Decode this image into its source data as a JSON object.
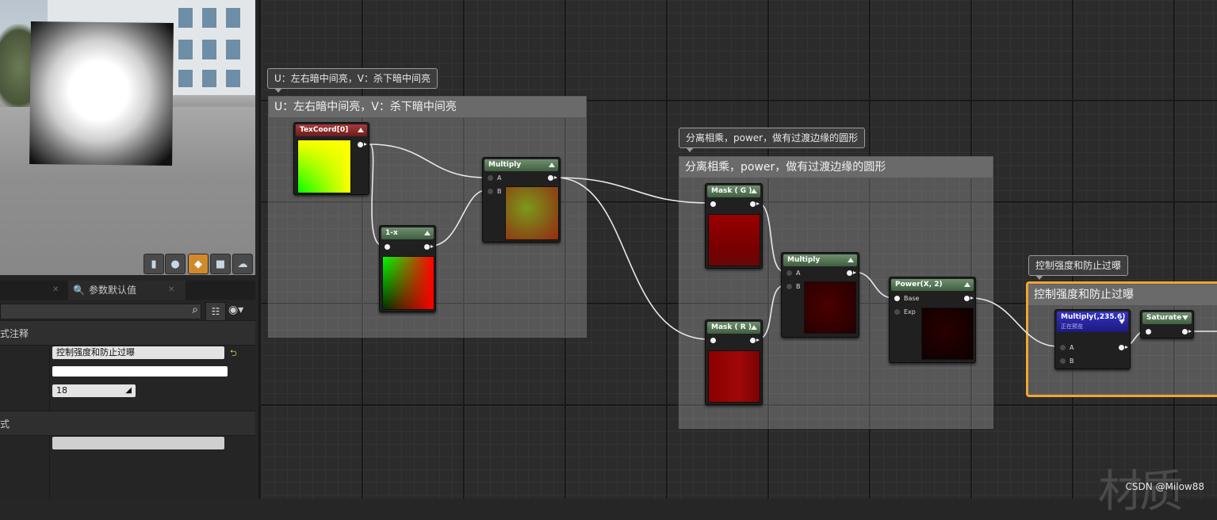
{
  "viewport": {
    "buttons": [
      "cylinder",
      "sphere",
      "plane",
      "cube",
      "custom-mesh"
    ],
    "active_button": "plane"
  },
  "details_panel": {
    "tab_label": "参数默认值",
    "section1_label": "式注释",
    "comment_text": "控制强度和防止过曝",
    "font_size": "18",
    "section2_label": "式"
  },
  "comments": [
    {
      "bubble": "U：左右暗中间亮，V：杀下暗中间亮",
      "title": "U：左右暗中间亮，V：杀下暗中间亮"
    },
    {
      "bubble": "分离相乘，power，做有过渡边缘的圆形",
      "title": "分离相乘，power，做有过渡边缘的圆形"
    },
    {
      "bubble": "控制强度和防止过曝",
      "title": "控制强度和防止过曝"
    }
  ],
  "nodes": {
    "texcoord": {
      "title": "TexCoord[0]"
    },
    "oneminus": {
      "title": "1-x"
    },
    "multiply1": {
      "title": "Multiply",
      "pin_a": "A",
      "pin_b": "B"
    },
    "maskg": {
      "title": "Mask ( G )"
    },
    "maskr": {
      "title": "Mask ( R )"
    },
    "multiply2": {
      "title": "Multiply",
      "pin_a": "A",
      "pin_b": "B"
    },
    "power": {
      "title": "Power(X, 2)",
      "pin_base": "Base",
      "pin_exp": "Exp"
    },
    "multiply3": {
      "title": "Multiply(,235.6)",
      "subtitle": "正在预览",
      "pin_a": "A",
      "pin_b": "B"
    },
    "saturate": {
      "title": "Saturate"
    }
  },
  "watermark": "CSDN @Milow88",
  "bg_mark": "材质"
}
